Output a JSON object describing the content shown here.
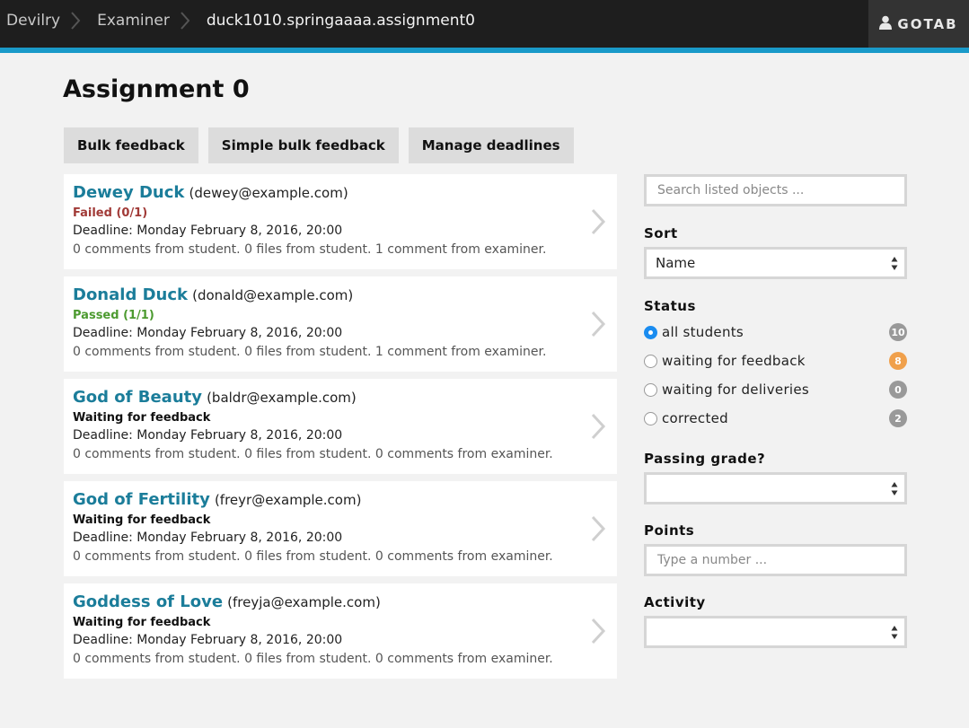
{
  "header": {
    "breadcrumbs": [
      "Devilry",
      "Examiner",
      "duck1010.springaaaa.assignment0"
    ],
    "user_label": "GOTAB"
  },
  "page": {
    "title": "Assignment 0",
    "actions": [
      "Bulk feedback",
      "Simple bulk feedback",
      "Manage deadlines"
    ]
  },
  "students": [
    {
      "name": "Dewey Duck",
      "email": "(dewey@example.com)",
      "status": "Failed (0/1)",
      "status_type": "failed",
      "deadline": "Deadline: Monday February 8, 2016, 20:00",
      "comments": "0 comments from student. 0 files from student. 1 comment from examiner."
    },
    {
      "name": "Donald Duck",
      "email": "(donald@example.com)",
      "status": "Passed (1/1)",
      "status_type": "passed",
      "deadline": "Deadline: Monday February 8, 2016, 20:00",
      "comments": "0 comments from student. 0 files from student. 1 comment from examiner."
    },
    {
      "name": "God of Beauty",
      "email": "(baldr@example.com)",
      "status": "Waiting for feedback",
      "status_type": "waiting",
      "deadline": "Deadline: Monday February 8, 2016, 20:00",
      "comments": "0 comments from student. 0 files from student. 0 comments from examiner."
    },
    {
      "name": "God of Fertility",
      "email": "(freyr@example.com)",
      "status": "Waiting for feedback",
      "status_type": "waiting",
      "deadline": "Deadline: Monday February 8, 2016, 20:00",
      "comments": "0 comments from student. 0 files from student. 0 comments from examiner."
    },
    {
      "name": "Goddess of Love",
      "email": "(freyja@example.com)",
      "status": "Waiting for feedback",
      "status_type": "waiting",
      "deadline": "Deadline: Monday February 8, 2016, 20:00",
      "comments": "0 comments from student. 0 files from student. 0 comments from examiner."
    }
  ],
  "sidebar": {
    "search_placeholder": "Search listed objects ...",
    "sort_label": "Sort",
    "sort_value": "Name",
    "status_label": "Status",
    "status_options": [
      {
        "label": "all students",
        "count": "10",
        "checked": true,
        "badge_color": "#999999"
      },
      {
        "label": "waiting for feedback",
        "count": "8",
        "checked": false,
        "badge_color": "#f0a04b"
      },
      {
        "label": "waiting for deliveries",
        "count": "0",
        "checked": false,
        "badge_color": "#999999"
      },
      {
        "label": "corrected",
        "count": "2",
        "checked": false,
        "badge_color": "#999999"
      }
    ],
    "passing_grade_label": "Passing grade?",
    "passing_grade_value": "",
    "points_label": "Points",
    "points_placeholder": "Type a number ...",
    "activity_label": "Activity",
    "activity_value": ""
  },
  "colors": {
    "accent": "#1a9ac9",
    "name_link": "#1b7d9a",
    "failed": "#a13a37",
    "passed": "#4c9a2f"
  },
  "icons": [
    "chevron-right-icon",
    "user-icon",
    "select-arrows-icon"
  ]
}
